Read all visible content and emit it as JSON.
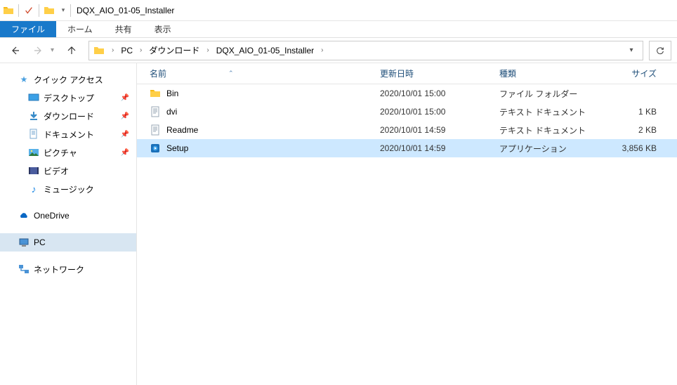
{
  "title": "DQX_AIO_01-05_Installer",
  "ribbon": {
    "file": "ファイル",
    "home": "ホーム",
    "share": "共有",
    "view": "表示"
  },
  "breadcrumb": [
    {
      "label": "PC"
    },
    {
      "label": "ダウンロード"
    },
    {
      "label": "DQX_AIO_01-05_Installer"
    }
  ],
  "sidebar": {
    "quick_access": "クイック アクセス",
    "desktop": "デスクトップ",
    "downloads": "ダウンロード",
    "documents": "ドキュメント",
    "pictures": "ピクチャ",
    "videos": "ビデオ",
    "music": "ミュージック",
    "onedrive": "OneDrive",
    "pc": "PC",
    "network": "ネットワーク"
  },
  "columns": {
    "name": "名前",
    "date": "更新日時",
    "type": "種類",
    "size": "サイズ"
  },
  "files": [
    {
      "name": "Bin",
      "date": "2020/10/01 15:00",
      "type": "ファイル フォルダー",
      "size": "",
      "icon": "folder",
      "selected": false
    },
    {
      "name": "dvi",
      "date": "2020/10/01 15:00",
      "type": "テキスト ドキュメント",
      "size": "1 KB",
      "icon": "text",
      "selected": false
    },
    {
      "name": "Readme",
      "date": "2020/10/01 14:59",
      "type": "テキスト ドキュメント",
      "size": "2 KB",
      "icon": "text",
      "selected": false
    },
    {
      "name": "Setup",
      "date": "2020/10/01 14:59",
      "type": "アプリケーション",
      "size": "3,856 KB",
      "icon": "app",
      "selected": true
    }
  ]
}
